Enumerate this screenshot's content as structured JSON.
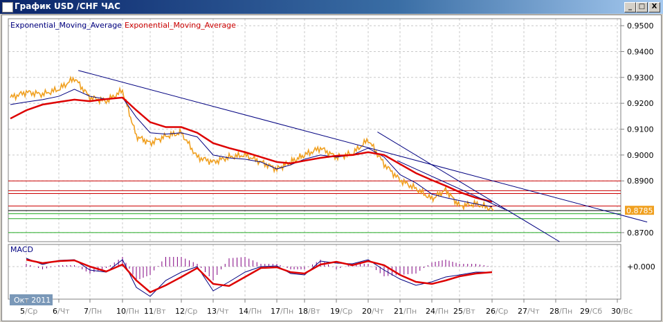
{
  "window": {
    "title": "График USD /CHF  ЧАС",
    "buttons": {
      "minimize": "_",
      "maximize": "□",
      "close": "X"
    }
  },
  "legend": [
    {
      "label": "Exponential_Moving_Average",
      "color": "#000080"
    },
    {
      "label": "Exponential_Moving_Average",
      "color": "#cc0000"
    }
  ],
  "macd_label": "MACD",
  "period_badge": "Окт 2011",
  "chart_data": {
    "type": "line",
    "price_axis": {
      "ticks": [
        "0.9500",
        "0.9400",
        "0.9300",
        "0.9200",
        "0.9100",
        "0.9000",
        "0.8900",
        "0.8700"
      ],
      "ylim": [
        0.8665,
        0.9527
      ]
    },
    "current_price": {
      "label": "0.8785",
      "value": 0.8785,
      "color": "#f0a020"
    },
    "date_ticks": [
      {
        "day": "5",
        "wd": "Ср"
      },
      {
        "day": "6",
        "wd": "Чт"
      },
      {
        "day": "7",
        "wd": "Пн"
      },
      {
        "day": "10",
        "wd": "Пн"
      },
      {
        "day": "11",
        "wd": "Вт"
      },
      {
        "day": "12",
        "wd": "Ср"
      },
      {
        "day": "13",
        "wd": "Чт"
      },
      {
        "day": "14",
        "wd": "Пн"
      },
      {
        "day": "17",
        "wd": "Пн"
      },
      {
        "day": "18",
        "wd": "Вт"
      },
      {
        "day": "19",
        "wd": "Ср"
      },
      {
        "day": "20",
        "wd": "Чт"
      },
      {
        "day": "21",
        "wd": "Пн"
      },
      {
        "day": "24",
        "wd": "Пн"
      },
      {
        "day": "25",
        "wd": "Вт"
      },
      {
        "day": "26",
        "wd": "Ср"
      },
      {
        "day": "27",
        "wd": "Чт"
      },
      {
        "day": "28",
        "wd": "Пн"
      },
      {
        "day": "29",
        "wd": "Сб"
      },
      {
        "day": "30",
        "wd": "Вс"
      }
    ],
    "price": {
      "color": "#f0a020",
      "values": [
        0.9222,
        0.9243,
        0.9235,
        0.9254,
        0.9297,
        0.9222,
        0.9208,
        0.9249,
        0.9073,
        0.9046,
        0.9073,
        0.9086,
        0.8992,
        0.8973,
        0.8992,
        0.9,
        0.8973,
        0.8946,
        0.8973,
        0.9,
        0.9027,
        0.8992,
        0.9005,
        0.9059,
        0.8965,
        0.8903,
        0.887,
        0.883,
        0.8865,
        0.8803,
        0.8811,
        0.8792
      ]
    },
    "ema_fast": {
      "color": "#000080",
      "values": [
        0.9195,
        0.9205,
        0.9214,
        0.9227,
        0.9254,
        0.9227,
        0.9216,
        0.9222,
        0.9146,
        0.9086,
        0.9081,
        0.9086,
        0.907,
        0.9,
        0.8989,
        0.8984,
        0.8973,
        0.8946,
        0.8962,
        0.8984,
        0.9,
        0.8992,
        0.9,
        0.9027,
        0.8992,
        0.8924,
        0.8892,
        0.8849,
        0.8835,
        0.8824,
        0.8811,
        0.88
      ]
    },
    "ema_slow": {
      "color": "#dd0000",
      "values": [
        0.9141,
        0.9173,
        0.9195,
        0.9205,
        0.9214,
        0.9208,
        0.9216,
        0.9222,
        0.9173,
        0.9127,
        0.9108,
        0.9108,
        0.9086,
        0.9046,
        0.9027,
        0.9011,
        0.8992,
        0.8973,
        0.8968,
        0.8978,
        0.8989,
        0.8997,
        0.9,
        0.9011,
        0.9,
        0.8965,
        0.893,
        0.8903,
        0.8881,
        0.8857,
        0.8835,
        0.8819
      ]
    },
    "levels": [
      {
        "value": 0.89,
        "color": "#cc0000"
      },
      {
        "value": 0.8862,
        "color": "#cc0000"
      },
      {
        "value": 0.8851,
        "color": "#cc0000"
      },
      {
        "value": 0.8803,
        "color": "#cc0000"
      },
      {
        "value": 0.8785,
        "color": "#000000"
      },
      {
        "value": 0.8773,
        "color": "#22aa22"
      },
      {
        "value": 0.8754,
        "color": "#22aa22"
      },
      {
        "value": 0.87,
        "color": "#22aa22"
      }
    ],
    "trendlines": [
      {
        "from": {
          "t": "2011-10-06 15:00",
          "p": 0.9327
        },
        "to": {
          "t": "2011-10-30 23:00",
          "p": 0.8741
        },
        "color": "#000080"
      },
      {
        "from": {
          "t": "2011-10-20 07:00",
          "p": 0.9089
        },
        "to": {
          "t": "2011-10-28 03:00",
          "p": 0.8659
        },
        "color": "#000080"
      },
      {
        "from": {
          "t": "2011-10-20 22:00",
          "p": 0.8978
        },
        "to": {
          "t": "2011-10-26 10:00",
          "p": 0.8789
        },
        "color": "#000080"
      }
    ],
    "macd": {
      "zero_label": "+0.000",
      "main": {
        "color": "#000080",
        "values": [
          0.0012,
          0.0003,
          0.0009,
          0.001,
          -0.0005,
          -0.0008,
          0.001,
          -0.003,
          -0.0043,
          -0.002,
          -0.0008,
          0.0,
          -0.0035,
          -0.0022,
          -0.0008,
          0.0,
          0.0001,
          -0.001,
          -0.0012,
          0.0008,
          0.0005,
          0.0004,
          0.001,
          -0.0005,
          -0.0018,
          -0.0027,
          -0.0022,
          -0.0015,
          -0.0012,
          -0.0008,
          -0.0008
        ]
      },
      "signal": {
        "color": "#dd0000",
        "values": [
          0.001,
          0.0005,
          0.0008,
          0.0009,
          0.0,
          -0.0007,
          0.0003,
          -0.002,
          -0.0037,
          -0.0027,
          -0.0015,
          -0.0002,
          -0.0025,
          -0.0028,
          -0.0015,
          -0.0002,
          -0.0001,
          -0.0008,
          -0.001,
          0.0003,
          0.0007,
          0.0002,
          0.0008,
          0.0002,
          -0.0012,
          -0.0022,
          -0.0025,
          -0.002,
          -0.0014,
          -0.001,
          -0.0008
        ]
      },
      "histogram_color": "#800080"
    }
  }
}
